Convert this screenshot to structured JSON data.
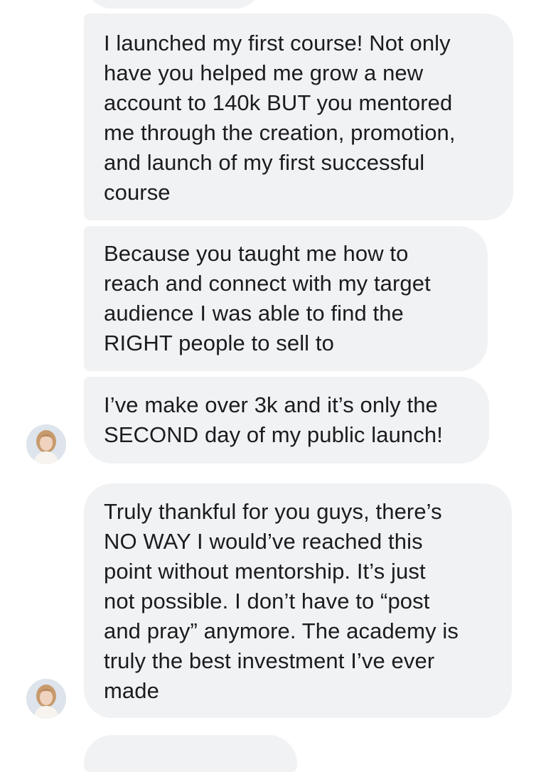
{
  "conversation": {
    "messages": [
      {
        "text": "I launched my first course! Not only\nhave you helped me grow a new\naccount to 140k BUT you mentored\nme through the creation, promotion,\nand launch of my first successful\ncourse"
      },
      {
        "text": "Because you taught me how to\nreach and connect with my target\naudience I was able to find the\nRIGHT people to sell to"
      },
      {
        "text": "I’ve make over 3k and it’s only the\nSECOND day of my public launch!"
      },
      {
        "text": "Truly thankful for you guys, there’s\nNO WAY I would’ve reached this\npoint without mentorship. It’s just\nnot possible. I don’t have to “post\nand pray” anymore. The academy is\ntruly the best investment I’ve ever\nmade"
      }
    ],
    "avatar_icon": "user-photo-avatar",
    "bubble_color": "#f1f2f4",
    "text_color": "#1c1c1e"
  }
}
